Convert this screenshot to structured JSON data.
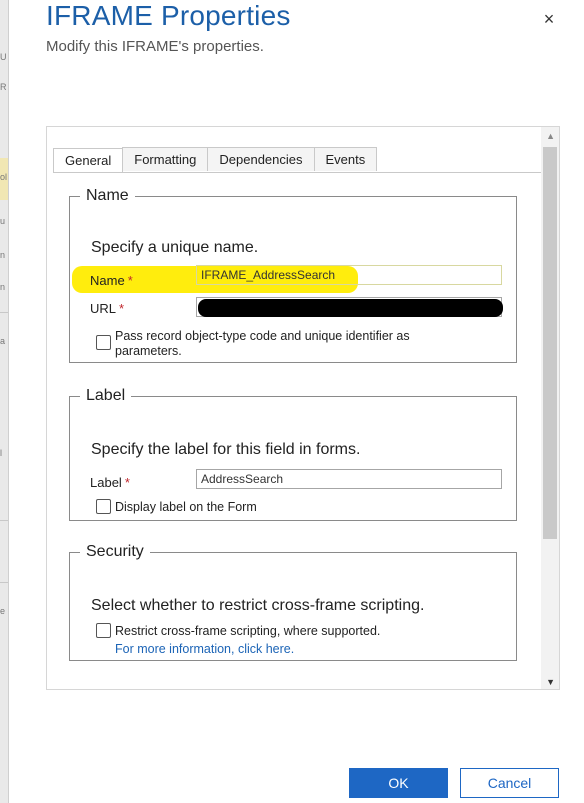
{
  "dialog": {
    "title": "IFRAME Properties",
    "subtitle": "Modify this IFRAME's properties.",
    "close_icon": "×"
  },
  "background_fragments": [
    "U",
    "R",
    "ol",
    "u",
    "n",
    "n",
    "a",
    "l",
    "e"
  ],
  "tabs": [
    {
      "label": "General",
      "active": true
    },
    {
      "label": "Formatting",
      "active": false
    },
    {
      "label": "Dependencies",
      "active": false
    },
    {
      "label": "Events",
      "active": false
    }
  ],
  "name_section": {
    "legend": "Name",
    "hint": "Specify a unique name.",
    "name_label": "Name",
    "name_value": "IFRAME_AddressSearch",
    "url_label": "URL",
    "url_value": "",
    "required_mark": "*",
    "pass_params_label_line1": "Pass record object-type code and unique identifier as",
    "pass_params_label_line2": "parameters.",
    "pass_params_checked": false
  },
  "label_section": {
    "legend": "Label",
    "hint": "Specify the label for this field in forms.",
    "label_label": "Label",
    "label_value": "AddressSearch",
    "required_mark": "*",
    "display_label": "Display label on the Form",
    "display_checked": false
  },
  "security_section": {
    "legend": "Security",
    "hint": "Select whether to restrict cross-frame scripting.",
    "restrict_label": "Restrict cross-frame scripting, where supported.",
    "restrict_checked": false,
    "more_info_link": "For more information, click here."
  },
  "scrollbar": {
    "up_icon": "▲",
    "down_icon": "▼"
  },
  "buttons": {
    "ok": "OK",
    "cancel": "Cancel"
  },
  "colors": {
    "accent": "#1e67c4",
    "title": "#1c5fa8",
    "required": "#c0262c",
    "highlight": "#ffec00"
  }
}
